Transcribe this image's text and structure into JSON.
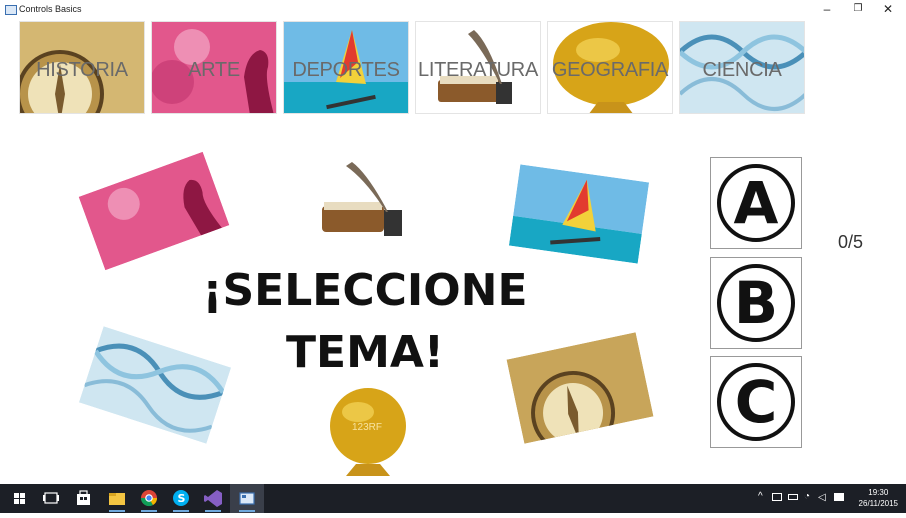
{
  "window": {
    "title": "Controls Basics",
    "min": "–",
    "max": "❐",
    "close": "✕"
  },
  "topics": [
    {
      "label": "HISTORIA",
      "image": "compass"
    },
    {
      "label": "ARTE",
      "image": "pink-silhouette"
    },
    {
      "label": "DEPORTES",
      "image": "windsurfer"
    },
    {
      "label": "LITERATURA",
      "image": "quill-and-book"
    },
    {
      "label": "GEOGRAFIA",
      "image": "golden-globe"
    },
    {
      "label": "CIENCIA",
      "image": "dna-helix"
    }
  ],
  "main": {
    "line1": "¡SELECCIONE",
    "line2": "TEMA!"
  },
  "globe_text": "123RF",
  "answers": [
    "A",
    "B",
    "C"
  ],
  "score": "0/5",
  "taskbar": {
    "time": "19:30",
    "date": "26/11/2015",
    "icons": [
      "start-icon",
      "task-view-icon",
      "store-icon",
      "file-explorer-icon",
      "chrome-icon",
      "skype-icon",
      "visual-studio-icon",
      "controls-basics-app-icon"
    ]
  }
}
